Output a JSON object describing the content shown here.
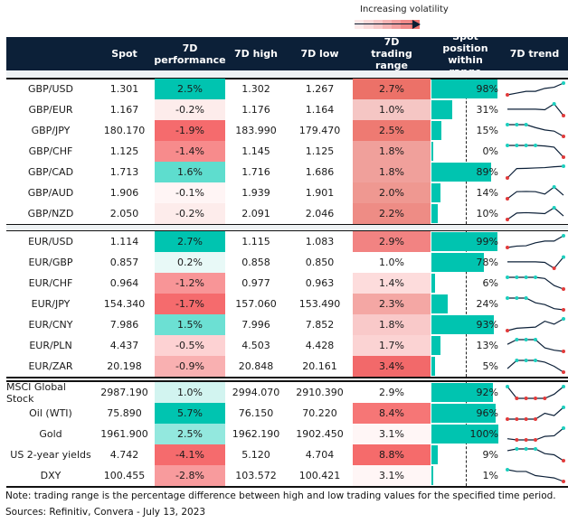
{
  "legend": {
    "label": "Increasing volatility",
    "gradient": [
      "#fde9e9",
      "#fbd9d9",
      "#f9c8c8",
      "#f6b3b3",
      "#f39f9f",
      "#f08a8a",
      "#ec7470"
    ]
  },
  "colors": {
    "header_bg": "#0c2038",
    "bar": "#00c4b0",
    "trend_line": "#0c2038",
    "high_dot": "#1ccfbe",
    "low_dot": "#e23b3b"
  },
  "headers": {
    "label": "",
    "spot": "Spot",
    "perf": "7D performance",
    "high": "7D high",
    "low": "7D low",
    "range": "7D trading range",
    "position": "Spot position within range",
    "trend": "7D trend"
  },
  "sections": [
    {
      "rows": [
        {
          "name": "GBP/USD",
          "spot": "1.301",
          "perf": "2.5%",
          "perf_color": "#00c4b0",
          "high": "1.302",
          "low": "1.267",
          "range": "2.7%",
          "range_color": "#ec7168",
          "position": 98,
          "trend": [
            0,
            0.15,
            0.3,
            0.3,
            0.55,
            0.65,
            1
          ]
        },
        {
          "name": "GBP/EUR",
          "spot": "1.167",
          "perf": "-0.2%",
          "perf_color": "#fdeceb",
          "high": "1.176",
          "low": "1.164",
          "range": "1.0%",
          "range_color": "#f5c6c4",
          "position": 31,
          "trend": [
            0.55,
            0.55,
            0.55,
            0.55,
            0.5,
            1,
            0
          ]
        },
        {
          "name": "GBP/JPY",
          "spot": "180.170",
          "perf": "-1.9%",
          "perf_color": "#f56b6d",
          "high": "183.990",
          "low": "179.470",
          "range": "2.5%",
          "range_color": "#ee7a72",
          "position": 15,
          "trend": [
            1,
            1,
            1,
            0.75,
            0.55,
            0.45,
            0
          ]
        },
        {
          "name": "GBP/CHF",
          "spot": "1.125",
          "perf": "-1.4%",
          "perf_color": "#f78b8c",
          "high": "1.145",
          "low": "1.125",
          "range": "1.8%",
          "range_color": "#f0a09b",
          "position": 0,
          "trend": [
            1,
            1,
            1,
            1,
            0.95,
            0.85,
            0
          ]
        },
        {
          "name": "GBP/CAD",
          "spot": "1.713",
          "perf": "1.6%",
          "perf_color": "#5eddce",
          "high": "1.716",
          "low": "1.686",
          "range": "1.8%",
          "range_color": "#f0a09b",
          "position": 89,
          "trend": [
            0,
            0.8,
            0.82,
            0.85,
            0.88,
            0.95,
            1
          ]
        },
        {
          "name": "GBP/AUD",
          "spot": "1.906",
          "perf": "-0.1%",
          "perf_color": "#fff5f5",
          "high": "1.939",
          "low": "1.901",
          "range": "2.0%",
          "range_color": "#ef9891",
          "position": 14,
          "trend": [
            0,
            0.6,
            0.62,
            0.6,
            0.4,
            1,
            0.3
          ]
        },
        {
          "name": "GBP/NZD",
          "spot": "2.050",
          "perf": "-0.2%",
          "perf_color": "#fdeceb",
          "high": "2.091",
          "low": "2.046",
          "range": "2.2%",
          "range_color": "#ee8c85",
          "position": 10,
          "trend": [
            0,
            0.55,
            0.58,
            0.55,
            0.5,
            1,
            0.3
          ]
        }
      ]
    },
    {
      "rows": [
        {
          "name": "EUR/USD",
          "spot": "1.114",
          "perf": "2.7%",
          "perf_color": "#00c4b0",
          "high": "1.115",
          "low": "1.083",
          "range": "2.9%",
          "range_color": "#f28382",
          "position": 99,
          "trend": [
            0,
            0.12,
            0.15,
            0.4,
            0.55,
            0.55,
            1
          ]
        },
        {
          "name": "EUR/GBP",
          "spot": "0.857",
          "perf": "0.2%",
          "perf_color": "#e8f9f7",
          "high": "0.858",
          "low": "0.850",
          "range": "1.0%",
          "range_color": "#ffffff",
          "position": 78,
          "trend": [
            0.55,
            0.55,
            0.55,
            0.55,
            0.5,
            0,
            0.95
          ]
        },
        {
          "name": "EUR/CHF",
          "spot": "0.964",
          "perf": "-1.2%",
          "perf_color": "#f89597",
          "high": "0.977",
          "low": "0.963",
          "range": "1.4%",
          "range_color": "#fddcdc",
          "position": 6,
          "trend": [
            1,
            1,
            1,
            1,
            0.9,
            0.3,
            0
          ]
        },
        {
          "name": "EUR/JPY",
          "spot": "154.340",
          "perf": "-1.7%",
          "perf_color": "#f56b6d",
          "high": "157.060",
          "low": "153.490",
          "range": "2.3%",
          "range_color": "#f4a7a4",
          "position": 24,
          "trend": [
            1,
            1,
            1,
            0.6,
            0.45,
            0.1,
            0
          ]
        },
        {
          "name": "EUR/CNY",
          "spot": "7.986",
          "perf": "1.5%",
          "perf_color": "#6ce0d3",
          "high": "7.996",
          "low": "7.852",
          "range": "1.8%",
          "range_color": "#f9c9c9",
          "position": 93,
          "trend": [
            0,
            0.2,
            0.25,
            0.3,
            0.8,
            0.55,
            1
          ]
        },
        {
          "name": "EUR/PLN",
          "spot": "4.437",
          "perf": "-0.5%",
          "perf_color": "#fdd2d3",
          "high": "4.503",
          "low": "4.428",
          "range": "1.7%",
          "range_color": "#fbd3d3",
          "position": 13,
          "trend": [
            0.6,
            1,
            1,
            1,
            0.3,
            0.1,
            0
          ]
        },
        {
          "name": "EUR/ZAR",
          "spot": "20.198",
          "perf": "-0.9%",
          "perf_color": "#f9b0b1",
          "high": "20.848",
          "low": "20.161",
          "range": "3.4%",
          "range_color": "#f2696a",
          "position": 5,
          "trend": [
            0.3,
            1,
            1,
            1,
            0.85,
            0.5,
            0
          ]
        }
      ]
    },
    {
      "rows": [
        {
          "name": "MSCI Global Stock",
          "spot": "2987.190",
          "perf": "1.0%",
          "perf_color": "#d2f4f0",
          "high": "2994.070",
          "low": "2910.390",
          "range": "2.9%",
          "range_color": "#ffffff",
          "position": 92,
          "trend": [
            1,
            0,
            0,
            0,
            0,
            0.35,
            1
          ]
        },
        {
          "name": "Oil (WTI)",
          "spot": "75.890",
          "perf": "5.7%",
          "perf_color": "#00c4b0",
          "high": "76.150",
          "low": "70.220",
          "range": "8.4%",
          "range_color": "#f67676",
          "position": 96,
          "trend": [
            0,
            0,
            0,
            0,
            0.5,
            0.3,
            1
          ]
        },
        {
          "name": "Gold",
          "spot": "1961.900",
          "perf": "2.5%",
          "perf_color": "#93e8de",
          "high": "1962.190",
          "low": "1902.450",
          "range": "3.1%",
          "range_color": "#fff6f6",
          "position": 100,
          "trend": [
            0.1,
            0,
            0,
            0,
            0.3,
            0.35,
            1
          ]
        },
        {
          "name": "US 2-year yields",
          "spot": "4.742",
          "perf": "-4.1%",
          "perf_color": "#f56b6d",
          "high": "5.120",
          "low": "4.704",
          "range": "8.8%",
          "range_color": "#f56b6b",
          "position": 9,
          "trend": [
            0.85,
            1,
            1,
            1,
            0.6,
            0.5,
            0
          ]
        },
        {
          "name": "DXY",
          "spot": "100.455",
          "perf": "-2.8%",
          "perf_color": "#f89b9d",
          "high": "103.572",
          "low": "100.421",
          "range": "3.1%",
          "range_color": "#fff6f6",
          "position": 1,
          "trend": [
            1,
            0.85,
            0.85,
            0.5,
            0.4,
            0.3,
            0
          ]
        }
      ]
    }
  ],
  "footer": {
    "note": "Note: trading range is the percentage difference between high and low trading values for the specified time period.",
    "sources": "Sources: Refinitiv, Convera - July 13, 2023"
  }
}
